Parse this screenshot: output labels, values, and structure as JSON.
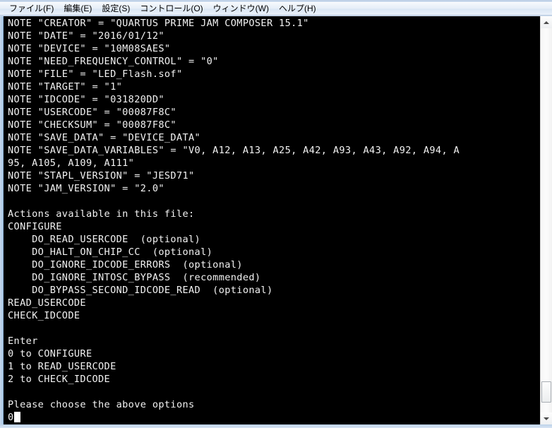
{
  "window": {
    "menubar": [
      {
        "label": "ファイル(F)",
        "name": "menu-file"
      },
      {
        "label": "編集(E)",
        "name": "menu-edit"
      },
      {
        "label": "設定(S)",
        "name": "menu-settings"
      },
      {
        "label": "コントロール(O)",
        "name": "menu-control"
      },
      {
        "label": "ウィンドウ(W)",
        "name": "menu-window"
      },
      {
        "label": "ヘルプ(H)",
        "name": "menu-help"
      }
    ]
  },
  "terminal": {
    "background_color": "#000000",
    "foreground_color": "#f2f2f2",
    "cursor": "block",
    "typed_input": "0",
    "lines": [
      "NOTE \"CREATOR\" = \"QUARTUS PRIME JAM COMPOSER 15.1\"",
      "NOTE \"DATE\" = \"2016/01/12\"",
      "NOTE \"DEVICE\" = \"10M08SAES\"",
      "NOTE \"NEED_FREQUENCY_CONTROL\" = \"0\"",
      "NOTE \"FILE\" = \"LED_Flash.sof\"",
      "NOTE \"TARGET\" = \"1\"",
      "NOTE \"IDCODE\" = \"031820DD\"",
      "NOTE \"USERCODE\" = \"00087F8C\"",
      "NOTE \"CHECKSUM\" = \"00087F8C\"",
      "NOTE \"SAVE_DATA\" = \"DEVICE_DATA\"",
      "NOTE \"SAVE_DATA_VARIABLES\" = \"V0, A12, A13, A25, A42, A93, A43, A92, A94, A",
      "95, A105, A109, A111\"",
      "NOTE \"STAPL_VERSION\" = \"JESD71\"",
      "NOTE \"JAM_VERSION\" = \"2.0\"",
      "",
      "Actions available in this file:",
      "CONFIGURE",
      "    DO_READ_USERCODE  (optional)",
      "    DO_HALT_ON_CHIP_CC  (optional)",
      "    DO_IGNORE_IDCODE_ERRORS  (optional)",
      "    DO_IGNORE_INTOSC_BYPASS  (recommended)",
      "    DO_BYPASS_SECOND_IDCODE_READ  (optional)",
      "READ_USERCODE",
      "CHECK_IDCODE",
      "",
      "Enter",
      "0 to CONFIGURE",
      "1 to READ_USERCODE",
      "2 to CHECK_IDCODE",
      "",
      "Please choose the above options"
    ]
  },
  "scrollbar": {
    "up_arrow": "▲",
    "down_arrow": "▼",
    "thumb_position": "near-bottom"
  }
}
